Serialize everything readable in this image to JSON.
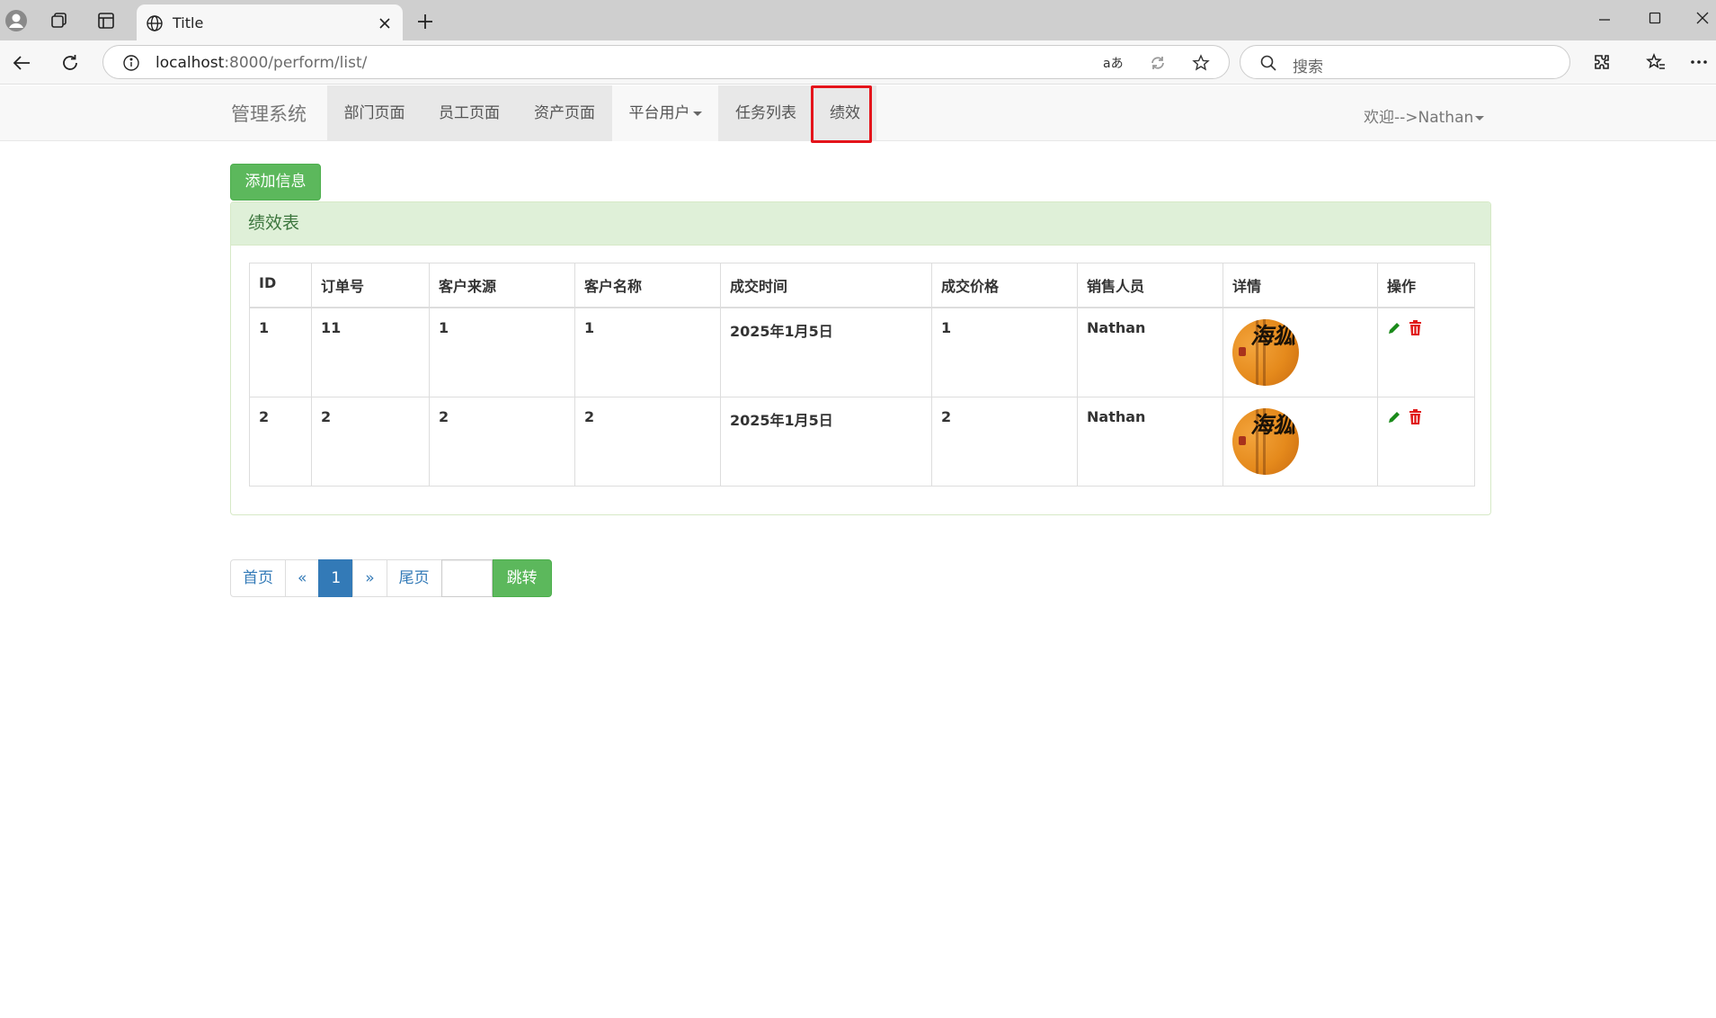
{
  "browser": {
    "tab_title": "Title",
    "url_host": "localhost",
    "url_path": ":8000/perform/list/",
    "search_placeholder": "搜索"
  },
  "navbar": {
    "brand": "管理系统",
    "items": [
      {
        "label": "部门页面"
      },
      {
        "label": "员工页面"
      },
      {
        "label": "资产页面"
      },
      {
        "label": "平台用户"
      },
      {
        "label": "任务列表"
      },
      {
        "label": "绩效"
      }
    ],
    "welcome": "欢迎-->Nathan"
  },
  "toolbar": {
    "add_label": "添加信息"
  },
  "panel": {
    "title": "绩效表"
  },
  "table": {
    "headers": [
      "ID",
      "订单号",
      "客户来源",
      "客户名称",
      "成交时间",
      "成交价格",
      "销售人员",
      "详情",
      "操作"
    ],
    "rows": [
      {
        "id": "1",
        "order": "11",
        "source": "1",
        "customer": "1",
        "time": "2025年1月5日",
        "price": "1",
        "sales": "Nathan"
      },
      {
        "id": "2",
        "order": "2",
        "source": "2",
        "customer": "2",
        "time": "2025年1月5日",
        "price": "2",
        "sales": "Nathan"
      }
    ],
    "avatar_text": "海狐"
  },
  "pagination": {
    "first": "首页",
    "prev": "«",
    "current": "1",
    "next": "»",
    "last": "尾页",
    "jump_label": "跳转"
  },
  "colors": {
    "success": "#5cb85c",
    "primary": "#337ab7",
    "panel_heading": "#dff0d8",
    "highlight": "#e4141b",
    "edit_icon": "#1a8a1a",
    "delete_icon": "#e01b1b"
  }
}
